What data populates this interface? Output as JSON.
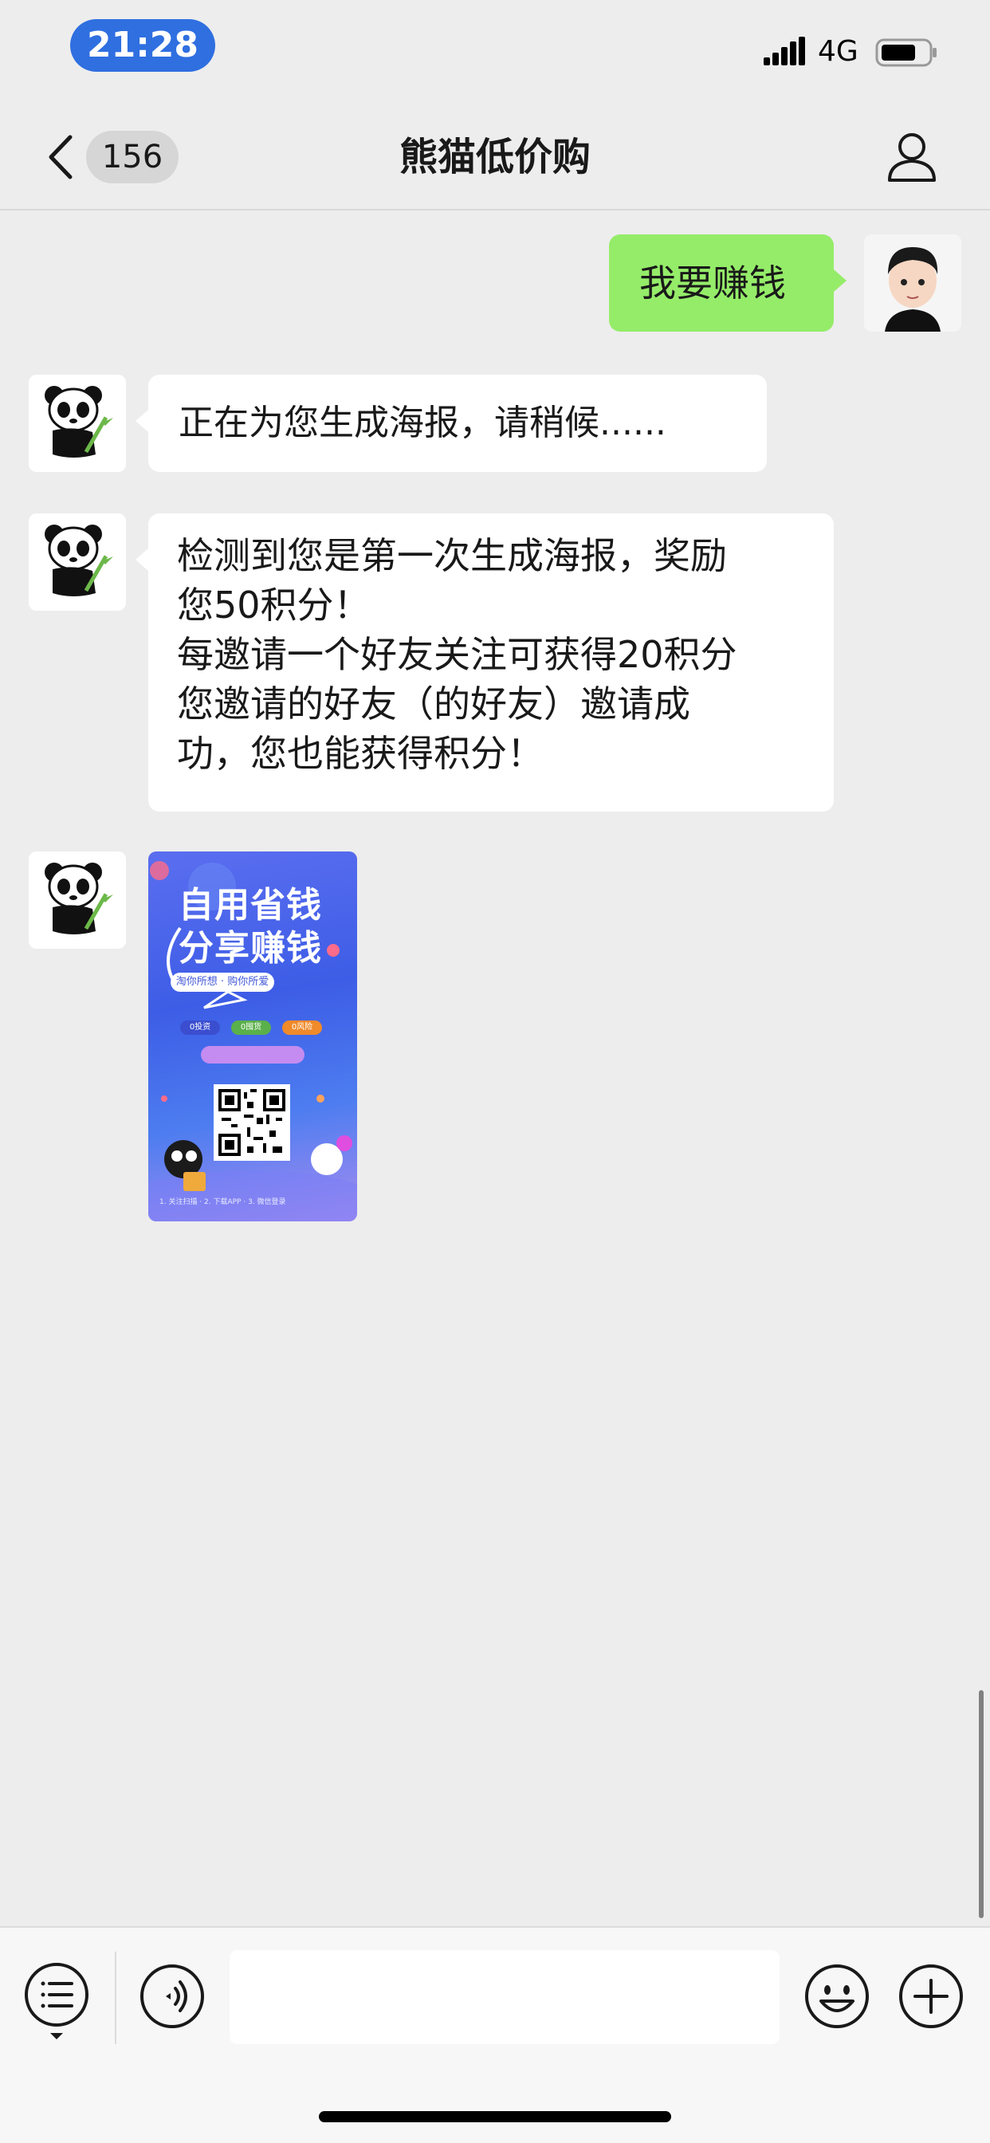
{
  "status_bar": {
    "time": "21:28",
    "network": "4G"
  },
  "nav": {
    "unread_count": "156",
    "title": "熊猫低价购"
  },
  "messages": [
    {
      "from": "me",
      "text": "我要赚钱"
    },
    {
      "from": "bot",
      "text": "正在为您生成海报，请稍候......"
    },
    {
      "from": "bot",
      "text": "检测到您是第一次生成海报，奖励\n您50积分！\n每邀请一个好友关注可获得20积分\n您邀请的好友（的好友）邀请成\n功，您也能获得积分！"
    }
  ],
  "poster": {
    "headline_line1": "自用省钱",
    "headline_line2": "分享赚钱",
    "slogan": "淘你所想 · 购你所爱",
    "tags": [
      "0投资",
      "0囤货",
      "0风险"
    ],
    "footer": "1. 关注扫描 · 2. 下载APP · 3. 微信登录"
  },
  "input": {
    "placeholder": ""
  },
  "colors": {
    "background": "#ededed",
    "outgoing_bubble": "#95ec69",
    "incoming_bubble": "#ffffff",
    "time_pill": "#2f6fe0"
  }
}
